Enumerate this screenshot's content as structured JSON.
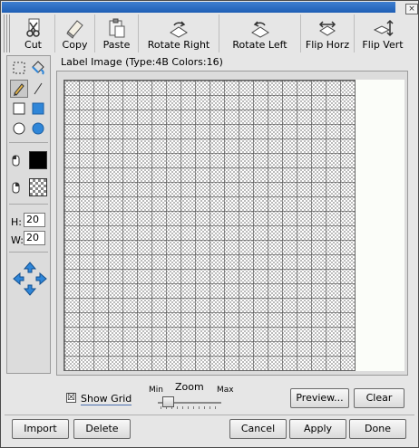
{
  "window": {
    "close_glyph": "×"
  },
  "toolbar": [
    {
      "label": "Cut",
      "icon": "scissors-icon"
    },
    {
      "label": "Copy",
      "icon": "copy-icon"
    },
    {
      "label": "Paste",
      "icon": "paste-icon"
    },
    {
      "label": "Rotate Right",
      "icon": "rotate-right-icon"
    },
    {
      "label": "Rotate Left",
      "icon": "rotate-left-icon"
    },
    {
      "label": "Flip Horz",
      "icon": "flip-horizontal-icon"
    },
    {
      "label": "Flip Vert",
      "icon": "flip-vertical-icon"
    }
  ],
  "tools": {
    "selection": "select-rectangle-icon",
    "fill": "paint-bucket-icon",
    "pencil": "pencil-icon",
    "line": "line-icon",
    "rect_outline": "rectangle-outline-icon",
    "rect_filled": "rectangle-filled-icon",
    "ellipse_outline": "ellipse-outline-icon",
    "ellipse_filled": "ellipse-filled-icon"
  },
  "colors": {
    "left_mouse": "#000000",
    "right_mouse": "transparent",
    "accent": "#2f86d8"
  },
  "size": {
    "h_label": "H:",
    "h_value": "20",
    "w_label": "W:",
    "w_value": "20"
  },
  "canvas": {
    "label": "Label Image (Type:4B Colors:16)",
    "grid_cells": 20
  },
  "controls": {
    "show_grid_label": "Show Grid",
    "show_grid_checked": "☒",
    "zoom_label": "Zoom",
    "zoom_min": "Min",
    "zoom_max": "Max",
    "preview_label": "Preview...",
    "clear_label": "Clear"
  },
  "footer": {
    "import_label": "Import",
    "delete_label": "Delete",
    "cancel_label": "Cancel",
    "apply_label": "Apply",
    "done_label": "Done"
  }
}
